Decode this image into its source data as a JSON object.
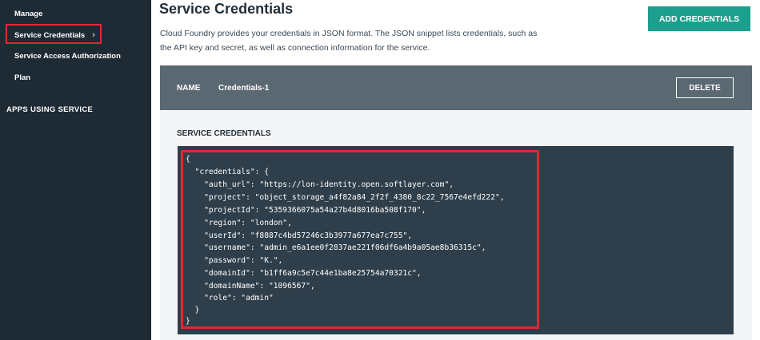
{
  "sidebar": {
    "items": [
      {
        "label": "Manage"
      },
      {
        "label": "Service Credentials"
      },
      {
        "label": "Service Access Authorization"
      },
      {
        "label": "Plan"
      }
    ],
    "section_label": "APPS USING SERVICE"
  },
  "header": {
    "title": "Service Credentials",
    "description": "Cloud Foundry provides your credentials in JSON format. The JSON snippet lists credentials, such as the API key and secret, as well as connection information for the service.",
    "add_button_label": "ADD CREDENTIALS"
  },
  "credential": {
    "name_label": "NAME",
    "name_value": "Credentials-1",
    "delete_label": "DELETE",
    "section_heading": "SERVICE CREDENTIALS",
    "json_lines": [
      "{",
      "  \"credentials\": {",
      "    \"auth_url\": \"https://lon-identity.open.softlayer.com\",",
      "    \"project\": \"object_storage_a4f82a84_2f2f_4380_8c22_7567e4efd222\",",
      "    \"projectId\": \"5359366075a54a27b4d8016ba508f170\",",
      "    \"region\": \"london\",",
      "    \"userId\": \"f8887c4bd57246c3b3977a677ea7c755\",",
      "    \"username\": \"admin_e6a1ee0f2837ae221f06df6a4b9a05ae8b36315c\",",
      "    \"password\": \"K.\",",
      "    \"domainId\": \"b1ff6a9c5e7c44e1ba8e25754a70321c\",",
      "    \"domainName\": \"1096567\",",
      "    \"role\": \"admin\"",
      "  }",
      "}"
    ]
  },
  "colors": {
    "sidebar_bg": "#1e2a34",
    "accent_teal": "#1c9f8c",
    "card_header_bg": "#5a6872",
    "code_bg": "#2e3e4a",
    "highlight_red": "#e02a2f"
  }
}
